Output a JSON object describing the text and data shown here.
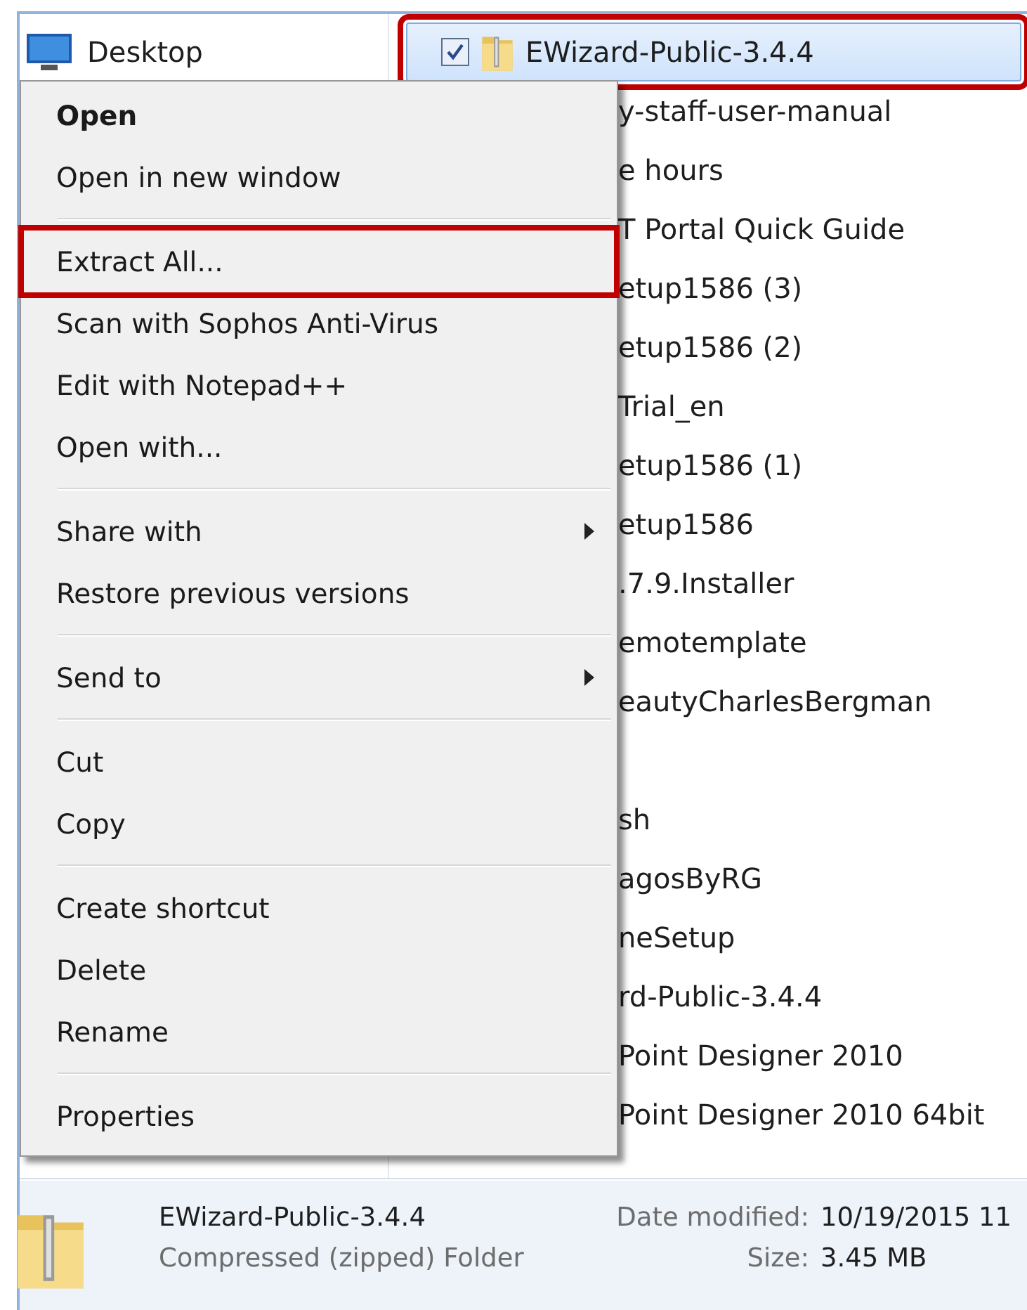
{
  "navigation_pane": {
    "items": [
      {
        "label": "Desktop"
      }
    ]
  },
  "file_list": {
    "items": [
      {
        "kind": "file",
        "name": "EWizard-Public-3.4.4",
        "selected": true,
        "checked": true,
        "highlighted": true
      },
      {
        "kind": "file",
        "name": "y-staff-user-manual",
        "selected": false,
        "highlighted": false
      },
      {
        "kind": "file",
        "name": "e hours",
        "selected": false,
        "highlighted": false
      },
      {
        "kind": "file",
        "name": "T Portal Quick Guide",
        "selected": false,
        "highlighted": false
      },
      {
        "kind": "file",
        "name": "etup1586 (3)",
        "selected": false,
        "highlighted": false
      },
      {
        "kind": "file",
        "name": "etup1586 (2)",
        "selected": false,
        "highlighted": false
      },
      {
        "kind": "file",
        "name": "Trial_en",
        "selected": false,
        "highlighted": false
      },
      {
        "kind": "file",
        "name": "etup1586 (1)",
        "selected": false,
        "highlighted": false
      },
      {
        "kind": "file",
        "name": "etup1586",
        "selected": false,
        "highlighted": false
      },
      {
        "kind": "file",
        "name": ".7.9.Installer",
        "selected": false,
        "highlighted": false
      },
      {
        "kind": "file",
        "name": "emotemplate",
        "selected": false,
        "highlighted": false
      },
      {
        "kind": "file",
        "name": "eautyCharlesBergman",
        "selected": false,
        "highlighted": false
      },
      {
        "kind": "blank"
      },
      {
        "kind": "file",
        "name": "sh",
        "selected": false,
        "highlighted": false
      },
      {
        "kind": "file",
        "name": "agosByRG",
        "selected": false,
        "highlighted": false
      },
      {
        "kind": "file",
        "name": "neSetup",
        "selected": false,
        "highlighted": false
      },
      {
        "kind": "file",
        "name": "rd-Public-3.4.4",
        "selected": false,
        "highlighted": false
      },
      {
        "kind": "file",
        "name": "Point Designer 2010",
        "selected": false,
        "highlighted": false
      },
      {
        "kind": "file",
        "name": "Point Designer 2010 64bit",
        "selected": false,
        "highlighted": false
      }
    ]
  },
  "context_menu": {
    "sections": [
      {
        "items": [
          {
            "kind": "default",
            "label": "Open",
            "highlighted": false
          },
          {
            "kind": "command",
            "label": "Open in new window",
            "highlighted": false
          }
        ]
      },
      {
        "items": [
          {
            "kind": "command",
            "label": "Extract All...",
            "highlighted": true
          },
          {
            "kind": "command",
            "label": "Scan with Sophos Anti-Virus",
            "highlighted": false
          },
          {
            "kind": "command",
            "label": "Edit with Notepad++",
            "highlighted": false
          },
          {
            "kind": "command",
            "label": "Open with...",
            "highlighted": false
          }
        ]
      },
      {
        "items": [
          {
            "kind": "submenu",
            "label": "Share with",
            "highlighted": false
          },
          {
            "kind": "command",
            "label": "Restore previous versions",
            "highlighted": false
          }
        ]
      },
      {
        "items": [
          {
            "kind": "submenu",
            "label": "Send to",
            "highlighted": false
          }
        ]
      },
      {
        "items": [
          {
            "kind": "command",
            "label": "Cut",
            "highlighted": false
          },
          {
            "kind": "command",
            "label": "Copy",
            "highlighted": false
          }
        ]
      },
      {
        "items": [
          {
            "kind": "command",
            "label": "Create shortcut",
            "highlighted": false
          },
          {
            "kind": "command",
            "label": "Delete",
            "highlighted": false
          },
          {
            "kind": "command",
            "label": "Rename",
            "highlighted": false
          }
        ]
      },
      {
        "items": [
          {
            "kind": "command",
            "label": "Properties",
            "highlighted": false
          }
        ]
      }
    ]
  },
  "details_pane": {
    "name": "EWizard-Public-3.4.4",
    "type": "Compressed (zipped) Folder",
    "fields": [
      {
        "label": "Date modified:",
        "value": "10/19/2015 11"
      },
      {
        "label": "Size:",
        "value": "3.45 MB"
      }
    ]
  }
}
